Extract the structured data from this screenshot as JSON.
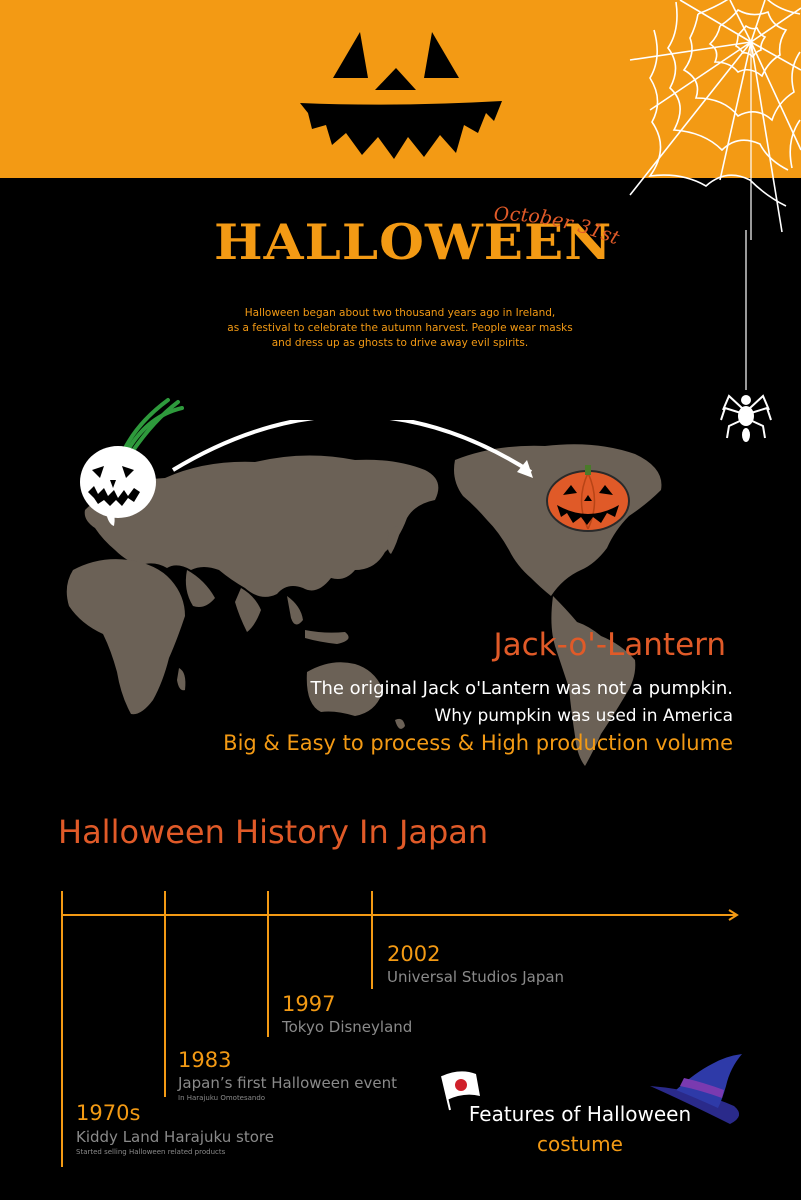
{
  "colors": {
    "orange": "#f39a14",
    "red_orange": "#e05a28",
    "map_land": "#6b6156",
    "background": "#000000",
    "gray_text": "#8a8a8a"
  },
  "icons": [
    "jack-o-lantern-face",
    "spider-web",
    "spider",
    "turnip-lantern",
    "pumpkin",
    "world-map",
    "japan-flag",
    "witch-hat"
  ],
  "header": {
    "title": "HALLOWEEN",
    "date": "October 31st"
  },
  "intro": {
    "lines": [
      "Halloween began about two thousand years ago in Ireland,",
      "as a festival to celebrate the autumn harvest. People wear masks",
      "and dress up as ghosts to drive away evil spirits."
    ]
  },
  "jack": {
    "heading": "Jack-o'-Lantern",
    "line1": "The original Jack o'Lantern was not a pumpkin.",
    "line2": "Why pumpkin was used in America",
    "line3": "Big & Easy to process & High production volume"
  },
  "history": {
    "title": "Halloween History In Japan",
    "events": [
      {
        "year": "1970s",
        "label": "Kiddy Land Harajuku store",
        "note": "Started selling Halloween related products"
      },
      {
        "year": "1983",
        "label": "Japan’s first Halloween event",
        "note": "In Harajuku Omotesando"
      },
      {
        "year": "1997",
        "label": "Tokyo Disneyland",
        "note": ""
      },
      {
        "year": "2002",
        "label": "Universal Studios Japan",
        "note": ""
      }
    ]
  },
  "features": {
    "title": "Features of Halloween",
    "subtitle": "costume"
  }
}
